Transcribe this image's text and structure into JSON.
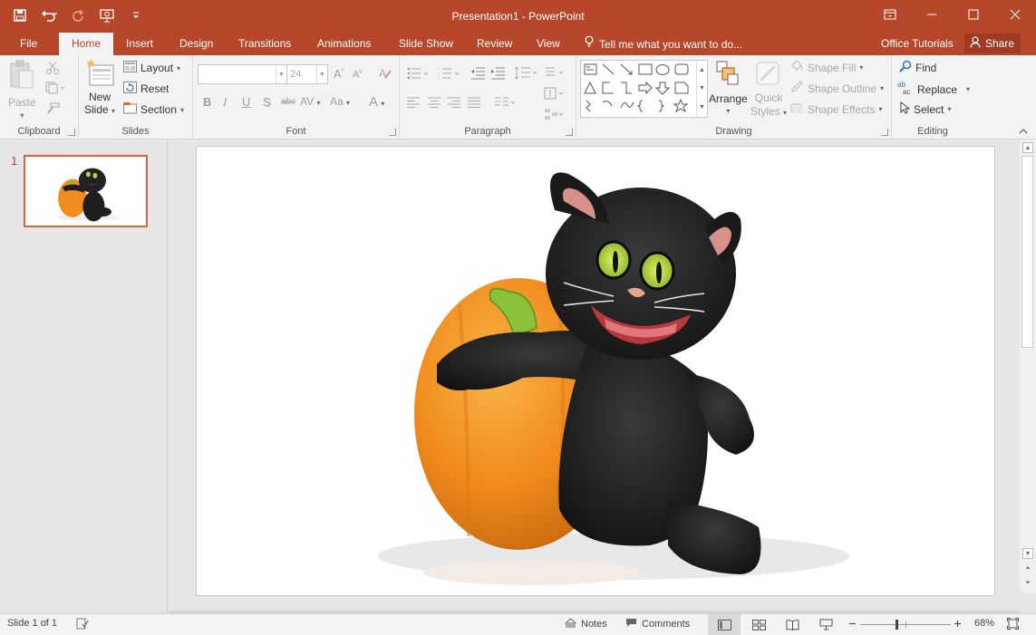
{
  "window": {
    "title": "Presentation1 - PowerPoint",
    "controls": [
      "restore-ribbon",
      "minimize",
      "maximize",
      "close"
    ]
  },
  "qat": {
    "icons": [
      "save-icon",
      "undo-icon",
      "redo-icon",
      "start-from-beginning-icon",
      "customize-qat-icon"
    ]
  },
  "tabs": [
    {
      "label": "File"
    },
    {
      "label": "Home",
      "active": true
    },
    {
      "label": "Insert"
    },
    {
      "label": "Design"
    },
    {
      "label": "Transitions"
    },
    {
      "label": "Animations"
    },
    {
      "label": "Slide Show"
    },
    {
      "label": "Review"
    },
    {
      "label": "View"
    }
  ],
  "tell_me": "Tell me what you want to do...",
  "office_tutorials": "Office Tutorials",
  "share": "Share",
  "ribbon": {
    "clipboard": {
      "label": "Clipboard",
      "paste": "Paste"
    },
    "slides": {
      "label": "Slides",
      "new_slide_1": "New",
      "new_slide_2": "Slide",
      "layout": "Layout",
      "reset": "Reset",
      "section": "Section"
    },
    "font": {
      "label": "Font",
      "font_name": "",
      "font_size": "24",
      "bold": "B",
      "italic": "I",
      "underline": "U",
      "shadow": "S",
      "strike": "abc",
      "spacing": "AV",
      "case": "Aa",
      "color": "A",
      "grow": "A",
      "shrink": "A"
    },
    "paragraph": {
      "label": "Paragraph"
    },
    "drawing": {
      "label": "Drawing",
      "arrange": "Arrange",
      "quick_styles_1": "Quick",
      "quick_styles_2": "Styles",
      "shape_fill": "Shape Fill",
      "shape_outline": "Shape Outline",
      "shape_effects": "Shape Effects"
    },
    "editing": {
      "label": "Editing",
      "find": "Find",
      "replace": "Replace",
      "select": "Select"
    }
  },
  "thumbnails": [
    {
      "number": "1"
    }
  ],
  "status": {
    "slide_info": "Slide 1 of 1",
    "notes": "Notes",
    "comments": "Comments",
    "zoom": "68%",
    "zoom_level_fraction": 0.4
  },
  "colors": {
    "accent": "#b7472a",
    "ribbon": "#f3f3f3",
    "workspace": "#e6e6e6",
    "thumb_selected": "#e3623c"
  }
}
